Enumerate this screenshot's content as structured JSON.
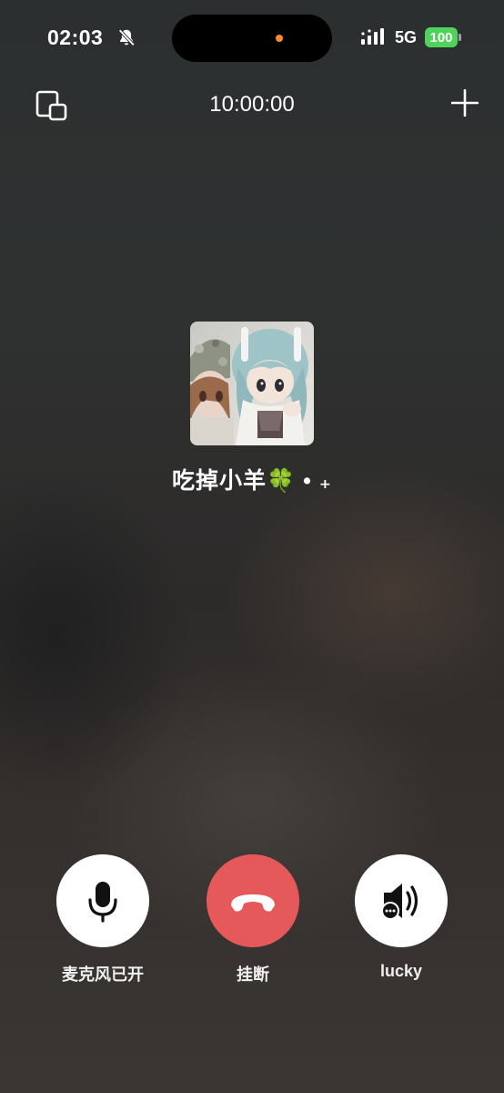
{
  "status_bar": {
    "time": "02:03",
    "network": "5G",
    "battery": "100",
    "icons": [
      "bell-off-icon",
      "signal-icon",
      "battery-icon"
    ]
  },
  "call": {
    "timer": "10:00:00",
    "contact_name": "吃掉小羊🍀 • ₊",
    "icons": [
      "minimize-window-icon",
      "add-participant-icon"
    ]
  },
  "controls": {
    "mic_label": "麦克风已开",
    "hangup_label": "挂断",
    "speaker_label": "lucky",
    "icons": [
      "microphone-icon",
      "hang-up-phone-icon",
      "speaker-icon"
    ]
  },
  "colors": {
    "hangup": "#e5595a",
    "battery": "#4fd35a",
    "island_dot": "#ff8a2a"
  }
}
